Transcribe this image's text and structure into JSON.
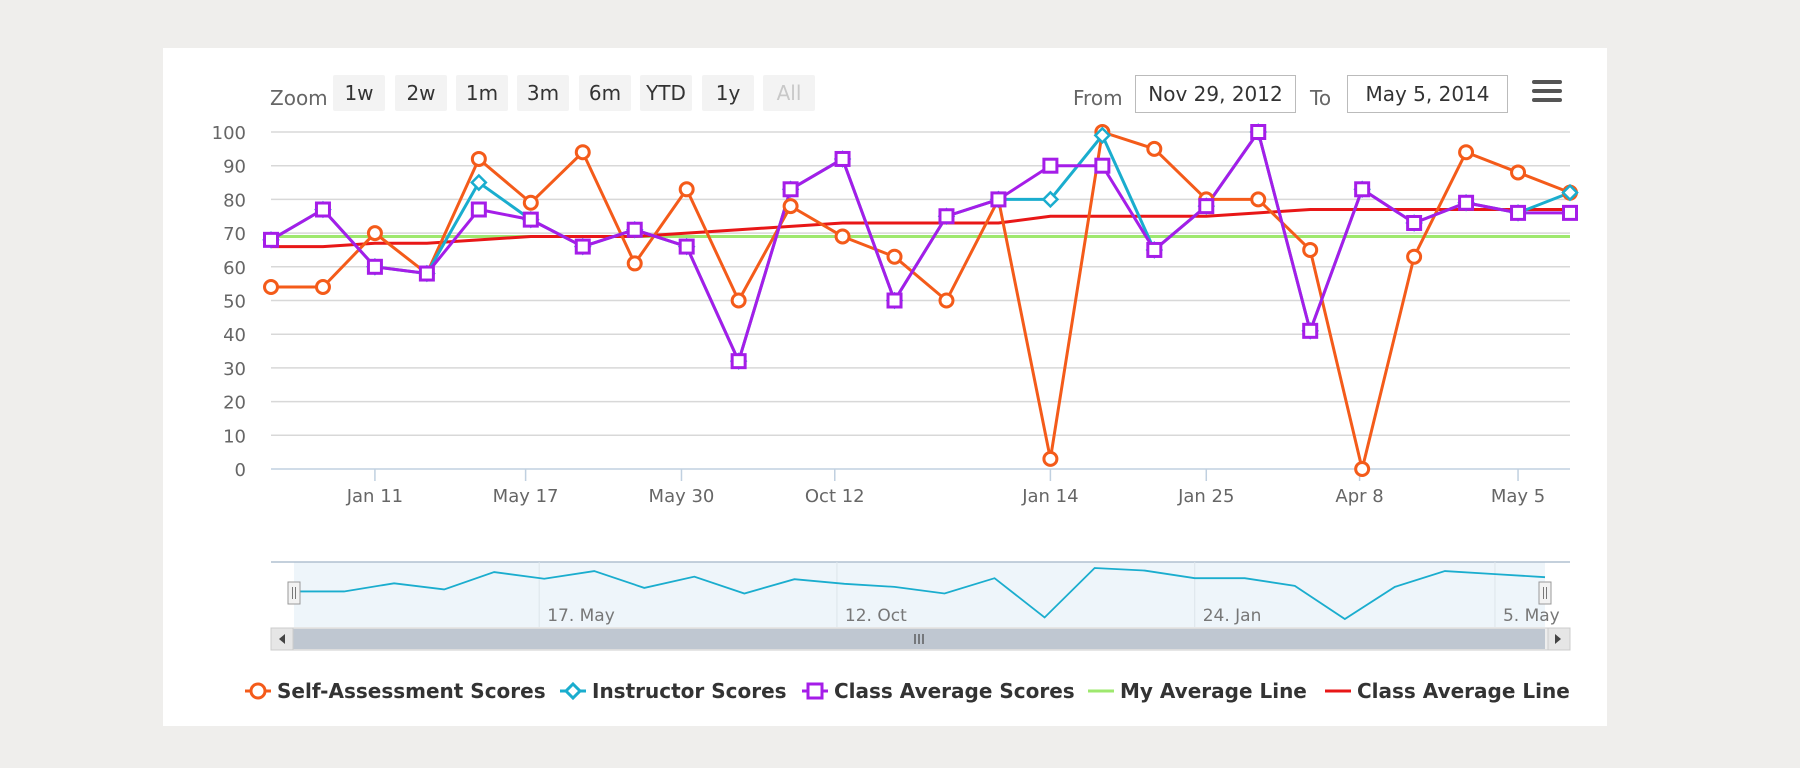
{
  "range_selector": {
    "zoom_label": "Zoom",
    "buttons": [
      {
        "label": "1w",
        "enabled": true
      },
      {
        "label": "2w",
        "enabled": true
      },
      {
        "label": "1m",
        "enabled": true
      },
      {
        "label": "3m",
        "enabled": true
      },
      {
        "label": "6m",
        "enabled": true
      },
      {
        "label": "YTD",
        "enabled": true
      },
      {
        "label": "1y",
        "enabled": true
      },
      {
        "label": "All",
        "enabled": false
      }
    ],
    "from_label": "From",
    "from_value": "Nov 29, 2012",
    "to_label": "To",
    "to_value": "May 5, 2014"
  },
  "chart_data": {
    "type": "line",
    "ylim": [
      0,
      100
    ],
    "y_ticks": [
      "0",
      "10",
      "20",
      "30",
      "40",
      "50",
      "60",
      "70",
      "80",
      "90",
      "100"
    ],
    "x_ticks": [
      {
        "label": "Jan 11",
        "at": 2.0
      },
      {
        "label": "May 17",
        "at": 4.9
      },
      {
        "label": "May 30",
        "at": 7.9
      },
      {
        "label": "Oct 12",
        "at": 10.85
      },
      {
        "label": "Jan 14",
        "at": 15.0
      },
      {
        "label": "Jan 25",
        "at": 18.0
      },
      {
        "label": "Apr 8",
        "at": 20.95
      },
      {
        "label": "May 5",
        "at": 24.0
      }
    ],
    "series": [
      {
        "name": "Self-Assessment Scores",
        "color": "#f45b1a",
        "marker": "circle",
        "values": [
          54,
          54,
          70,
          58,
          92,
          79,
          94,
          61,
          83,
          50,
          78,
          69,
          63,
          50,
          80,
          3,
          100,
          95,
          80,
          80,
          65,
          0,
          63,
          94,
          88,
          82
        ]
      },
      {
        "name": "Instructor Scores",
        "color": "#1aadce",
        "marker": "diamond",
        "values": [
          68,
          77,
          60,
          58,
          85,
          74,
          66,
          71,
          66,
          32,
          83,
          92,
          50,
          75,
          80,
          80,
          99,
          65,
          78,
          100,
          41,
          83,
          73,
          79,
          76,
          82
        ]
      },
      {
        "name": "Class Average Scores",
        "color": "#a51de8",
        "marker": "square",
        "values": [
          68,
          77,
          60,
          58,
          77,
          74,
          66,
          71,
          66,
          32,
          83,
          92,
          50,
          75,
          80,
          90,
          90,
          65,
          78,
          100,
          41,
          83,
          73,
          79,
          76,
          76
        ]
      },
      {
        "name": "My Average Line",
        "color": "#9ee86e",
        "marker": "none",
        "values": [
          69,
          69,
          69,
          69,
          69,
          69,
          69,
          69,
          69,
          69,
          69,
          69,
          69,
          69,
          69,
          69,
          69,
          69,
          69,
          69,
          69,
          69,
          69,
          69,
          69,
          69
        ]
      },
      {
        "name": "Class Average Line",
        "color": "#e81717",
        "marker": "none",
        "values": [
          66,
          66,
          67,
          67,
          68,
          69,
          69,
          69,
          70,
          71,
          72,
          73,
          73,
          73,
          73,
          75,
          75,
          75,
          75,
          76,
          77,
          77,
          77,
          77,
          77,
          77
        ]
      }
    ],
    "navigator": {
      "x_ticks": [
        {
          "label": "17. May",
          "at": 4.9
        },
        {
          "label": "12. Oct",
          "at": 10.85
        },
        {
          "label": "24. Jan",
          "at": 18.0
        },
        {
          "label": "5. May",
          "at": 24.0
        }
      ]
    },
    "legend_placement": "bottom-center",
    "grid": true
  }
}
